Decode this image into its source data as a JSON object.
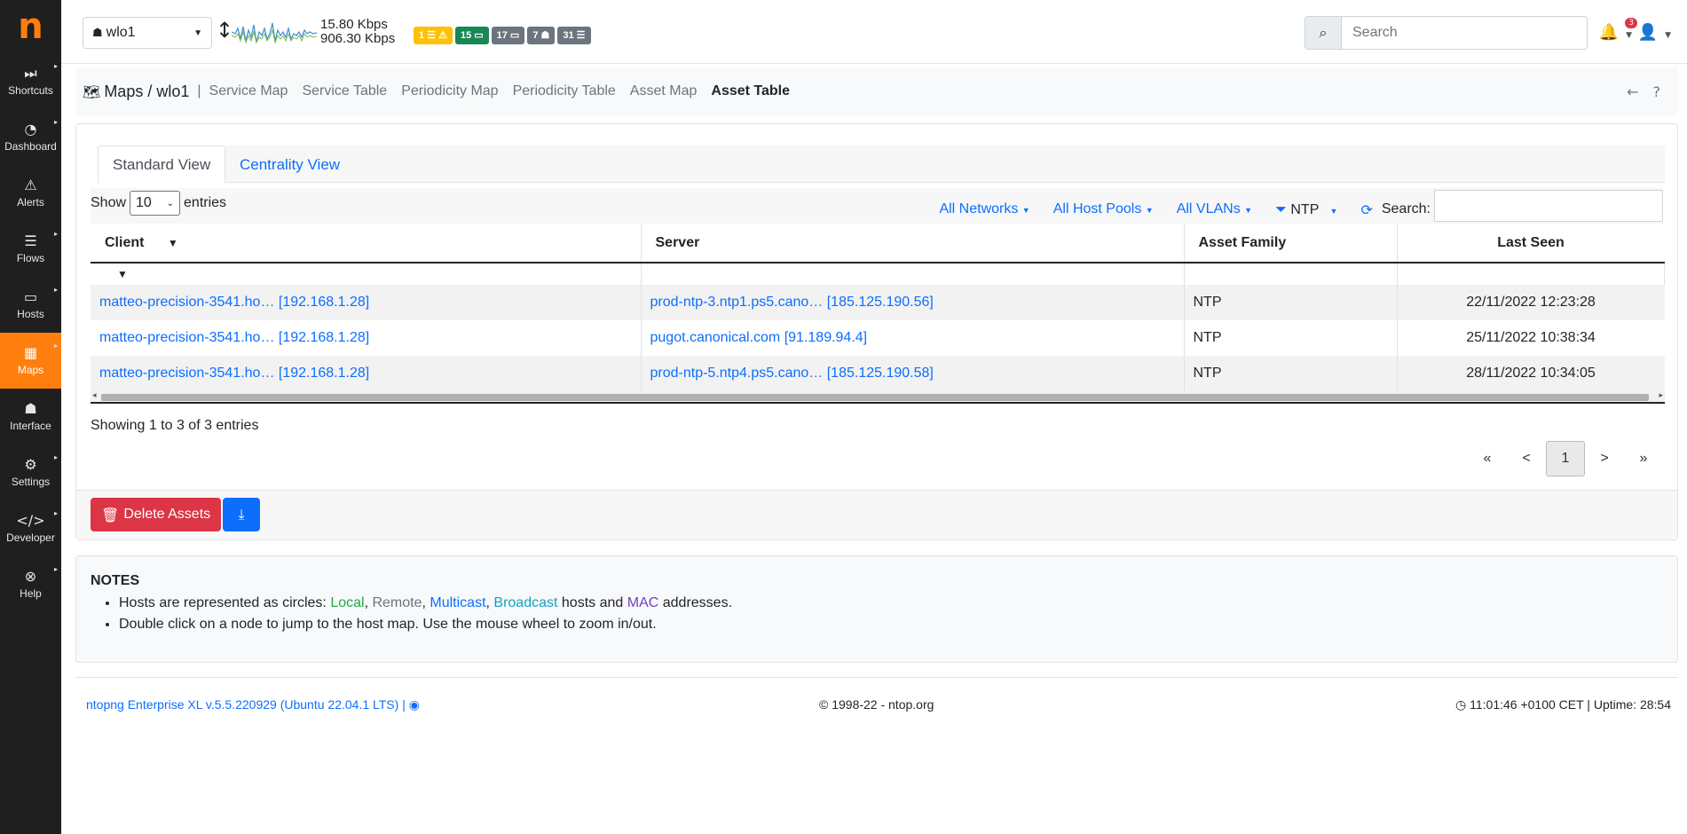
{
  "app": {
    "logo": "n"
  },
  "sidebar": {
    "items": [
      {
        "label": "Shortcuts",
        "icon": "⏭"
      },
      {
        "label": "Dashboard",
        "icon": "◔"
      },
      {
        "label": "Alerts",
        "icon": "⚠"
      },
      {
        "label": "Flows",
        "icon": "☰"
      },
      {
        "label": "Hosts",
        "icon": "▭"
      },
      {
        "label": "Maps",
        "icon": "▦"
      },
      {
        "label": "Interface",
        "icon": "☗"
      },
      {
        "label": "Settings",
        "icon": "⚙"
      },
      {
        "label": "Developer",
        "icon": "</>"
      },
      {
        "label": "Help",
        "icon": "⊗"
      }
    ],
    "active": "Maps",
    "accent": "#ff7f0e"
  },
  "topbar": {
    "interface": "wlo1",
    "upload": "15.80 Kbps",
    "download": "906.30 Kbps",
    "badges": [
      {
        "text": "1 ☰ ⚠",
        "color": "#ffc107"
      },
      {
        "text": "15 ▭",
        "color": "#198754"
      },
      {
        "text": "17 ▭",
        "color": "#6c757d"
      },
      {
        "text": "7 ☗",
        "color": "#6c757d"
      },
      {
        "text": "31 ☰",
        "color": "#6c757d"
      }
    ],
    "search_placeholder": "Search",
    "notifications_count": "3"
  },
  "breadcrumb": {
    "title": "Maps / wlo1",
    "sep": "|",
    "nav": [
      "Service Map",
      "Service Table",
      "Periodicity Map",
      "Periodicity Table",
      "Asset Map",
      "Asset Table"
    ],
    "active": "Asset Table"
  },
  "tabs": {
    "standard": "Standard View",
    "centrality": "Centrality View"
  },
  "controls": {
    "show": "Show",
    "entries_value": "10",
    "entries": "entries",
    "networks": "All Networks",
    "pools": "All Host Pools",
    "vlans": "All VLANs",
    "protocol": "NTP",
    "search_label": "Search:"
  },
  "table": {
    "headers": {
      "client": "Client",
      "server": "Server",
      "family": "Asset Family",
      "last_seen": "Last Seen"
    },
    "sort_indicator": "▼",
    "rows": [
      {
        "client": "matteo-precision-3541.ho… [192.168.1.28]",
        "server": "prod-ntp-3.ntp1.ps5.cano… [185.125.190.56]",
        "family": "NTP",
        "last_seen": "22/11/2022 12:23:28"
      },
      {
        "client": "matteo-precision-3541.ho… [192.168.1.28]",
        "server": "pugot.canonical.com [91.189.94.4]",
        "family": "NTP",
        "last_seen": "25/11/2022 10:38:34"
      },
      {
        "client": "matteo-precision-3541.ho… [192.168.1.28]",
        "server": "prod-ntp-5.ntp4.ps5.cano… [185.125.190.58]",
        "family": "NTP",
        "last_seen": "28/11/2022 10:34:05"
      }
    ],
    "info": "Showing 1 to 3 of 3 entries"
  },
  "pagination": {
    "first": "«",
    "prev": "<",
    "current": "1",
    "next": ">",
    "last": "»"
  },
  "actions": {
    "delete": "Delete Assets"
  },
  "notes": {
    "title": "NOTES",
    "line1_prefix": "Hosts are represented as circles: ",
    "local": "Local",
    "remote": "Remote",
    "multicast": "Multicast",
    "broadcast": "Broadcast",
    "hosts_and": " hosts and ",
    "mac": "MAC",
    "addresses": " addresses.",
    "line2": "Double click on a node to jump to the host map. Use the mouse wheel to zoom in/out."
  },
  "footer": {
    "version": "ntopng Enterprise XL v.5.5.220929 (Ubuntu 22.04.1 LTS) |",
    "copyright": "© 1998-22 - ntop.org",
    "status": "11:01:46 +0100 CET | Uptime: 28:54"
  }
}
